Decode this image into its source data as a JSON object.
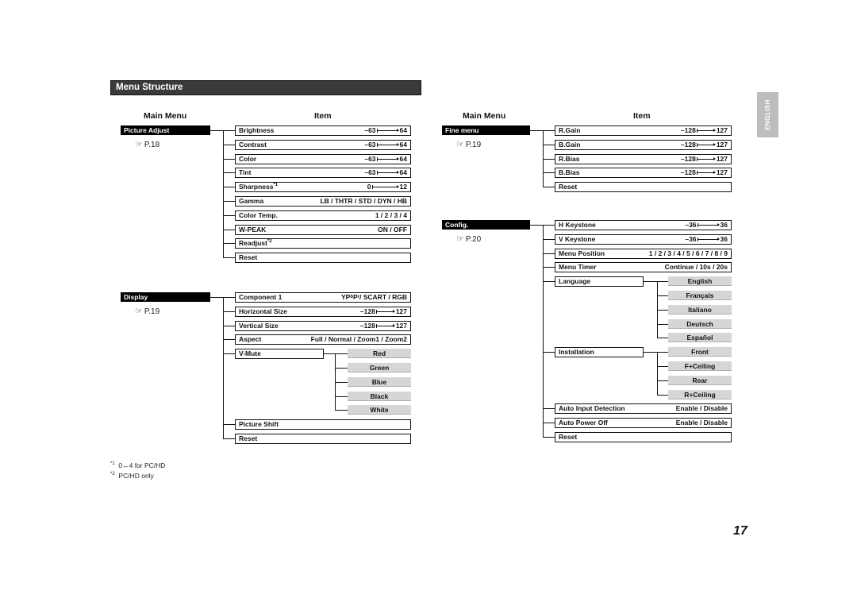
{
  "title": "Menu Structure",
  "side_tab": "ENGLISH",
  "page_number": "17",
  "column_headers": {
    "main_menu": "Main Menu",
    "item": "Item"
  },
  "left": {
    "menus": [
      {
        "name": "Picture Adjust",
        "page_ref": "P.18",
        "items": [
          {
            "label": "Brightness",
            "min": "–63",
            "max": "64",
            "type": "range"
          },
          {
            "label": "Contrast",
            "min": "–63",
            "max": "64",
            "type": "range"
          },
          {
            "label": "Color",
            "min": "–63",
            "max": "64",
            "type": "range"
          },
          {
            "label": "Tint",
            "min": "–63",
            "max": "64",
            "type": "range"
          },
          {
            "label": "Sharpness",
            "note": "*1",
            "min": "0",
            "max": "12",
            "type": "range"
          },
          {
            "label": "Gamma",
            "value": "LB / THTR / STD / DYN / HB",
            "type": "text"
          },
          {
            "label": "Color Temp.",
            "value": "1 / 2 / 3 / 4",
            "type": "text"
          },
          {
            "label": "W-PEAK",
            "value": "ON / OFF",
            "type": "text"
          },
          {
            "label": "Readjust",
            "note": "*2",
            "type": "none"
          },
          {
            "label": "Reset",
            "type": "none"
          }
        ]
      },
      {
        "name": "Display",
        "page_ref": "P.19",
        "items": [
          {
            "label": "Component 1",
            "value": "YPbPr / SCART / RGB",
            "type": "text"
          },
          {
            "label": "Horizontal Size",
            "min": "–128",
            "max": "127",
            "type": "range"
          },
          {
            "label": "Vertical Size",
            "min": "–128",
            "max": "127",
            "type": "range"
          },
          {
            "label": "Aspect",
            "value": "Full / Normal / Zoom1 / Zoom2",
            "type": "text"
          },
          {
            "label": "V-Mute",
            "type": "sub",
            "options": [
              "Red",
              "Green",
              "Blue",
              "Black",
              "White"
            ]
          },
          {
            "label": "Picture Shift",
            "type": "none"
          },
          {
            "label": "Reset",
            "type": "none"
          }
        ]
      }
    ]
  },
  "right": {
    "menus": [
      {
        "name": "Fine menu",
        "page_ref": "P.19",
        "items": [
          {
            "label": "R.Gain",
            "min": "–128",
            "max": "127",
            "type": "range"
          },
          {
            "label": "B.Gain",
            "min": "–128",
            "max": "127",
            "type": "range"
          },
          {
            "label": "R.Bias",
            "min": "–128",
            "max": "127",
            "type": "range"
          },
          {
            "label": "B.Bias",
            "min": "–128",
            "max": "127",
            "type": "range"
          },
          {
            "label": "Reset",
            "type": "none"
          }
        ]
      },
      {
        "name": "Config.",
        "page_ref": "P.20",
        "items": [
          {
            "label": "H Keystone",
            "min": "–36",
            "max": "36",
            "type": "range"
          },
          {
            "label": "V Keystone",
            "min": "–36",
            "max": "36",
            "type": "range"
          },
          {
            "label": "Menu Position",
            "value": "1 / 2 / 3 / 4 / 5 / 6 / 7 / 8 / 9",
            "type": "text"
          },
          {
            "label": "Menu Timer",
            "value": "Continue / 10s / 20s",
            "type": "text"
          },
          {
            "label": "Language",
            "type": "sub",
            "options": [
              "English",
              "Français",
              "Italiano",
              "Deutsch",
              "Español"
            ]
          },
          {
            "label": "Installation",
            "type": "sub",
            "options": [
              "Front",
              "F+Ceiling",
              "Rear",
              "R+Ceiling"
            ]
          },
          {
            "label": "Auto Input Detection",
            "value": "Enable / Disable",
            "type": "text"
          },
          {
            "label": "Auto Power Off",
            "value": "Enable / Disable",
            "type": "text"
          },
          {
            "label": "Reset",
            "type": "none"
          }
        ]
      }
    ]
  },
  "footnotes": [
    {
      "mark": "*1",
      "text": "0↔4 for PC/HD"
    },
    {
      "mark": "*2",
      "text": "PC/HD only"
    }
  ],
  "icons": {
    "page_ref": "pointing-hand-icon"
  }
}
